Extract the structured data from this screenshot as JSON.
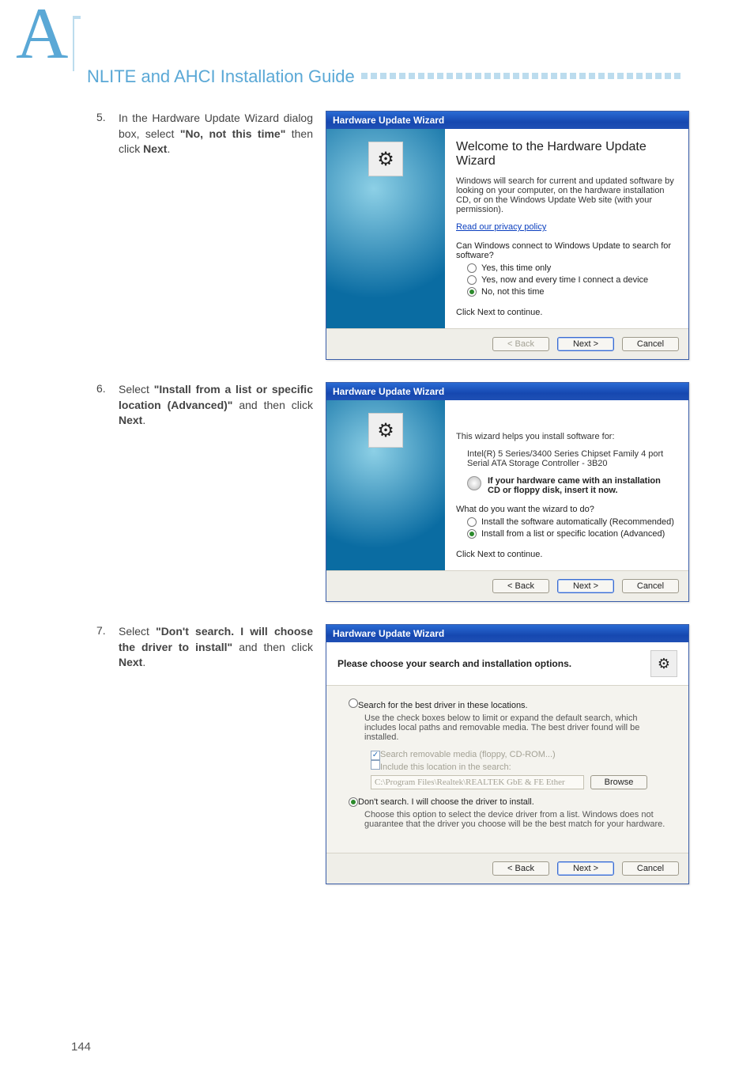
{
  "page": {
    "appendix_letter": "A",
    "title": "NLITE and AHCI Installation Guide",
    "number": "144"
  },
  "steps": [
    {
      "num": "5.",
      "pre": "In the Hardware Update Wizard dialog box, select ",
      "bold": "\"No, not this time\"",
      "mid": " then click ",
      "bold2": "Next",
      "post": "."
    },
    {
      "num": "6.",
      "pre": "Select ",
      "bold": "\"Install from a list or specific location (Advanced)\"",
      "mid": " and then click ",
      "bold2": "Next",
      "post": "."
    },
    {
      "num": "7.",
      "pre": "Select ",
      "bold": "\"Don't search. I will choose the driver to install\"",
      "mid": " and then click ",
      "bold2": "Next",
      "post": "."
    }
  ],
  "wiz1": {
    "title": "Hardware Update Wizard",
    "heading": "Welcome to the Hardware Update Wizard",
    "intro": "Windows will search for current and updated software by looking on your computer, on the hardware installation CD, or on the Windows Update Web site (with your permission).",
    "privacy_link": "Read our privacy policy",
    "question": "Can Windows connect to Windows Update to search for software?",
    "opt1": "Yes, this time only",
    "opt2": "Yes, now and every time I connect a device",
    "opt3": "No, not this time",
    "continue": "Click Next to continue.",
    "btn_back": "< Back",
    "btn_next": "Next >",
    "btn_cancel": "Cancel"
  },
  "wiz2": {
    "title": "Hardware Update Wizard",
    "help": "This wizard helps you install software for:",
    "device": "Intel(R) 5 Series/3400 Series Chipset Family 4 port Serial ATA Storage Controller - 3B20",
    "cdnote": "If your hardware came with an installation CD or floppy disk, insert it now.",
    "question": "What do you want the wizard to do?",
    "opt1": "Install the software automatically (Recommended)",
    "opt2": "Install from a list or specific location (Advanced)",
    "continue": "Click Next to continue.",
    "btn_back": "< Back",
    "btn_next": "Next >",
    "btn_cancel": "Cancel"
  },
  "wiz3": {
    "title": "Hardware Update Wizard",
    "heading": "Please choose your search and installation options.",
    "opt1": "Search for the best driver in these locations.",
    "opt1_desc": "Use the check boxes below to limit or expand the default search, which includes local paths and removable media. The best driver found will be installed.",
    "chk1": "Search removable media (floppy, CD-ROM...)",
    "chk2": "Include this location in the search:",
    "path": "C:\\Program Files\\Realtek\\REALTEK GbE & FE Ether",
    "browse": "Browse",
    "opt2": "Don't search. I will choose the driver to install.",
    "opt2_desc": "Choose this option to select the device driver from a list.  Windows does not guarantee that the driver you choose will be the best match for your hardware.",
    "btn_back": "< Back",
    "btn_next": "Next >",
    "btn_cancel": "Cancel"
  }
}
